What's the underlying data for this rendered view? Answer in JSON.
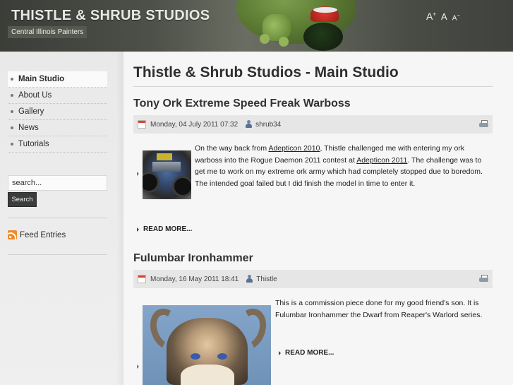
{
  "header": {
    "site_title": "THISTLE & SHRUB STUDIOS",
    "tagline": "Central Illinois Painters",
    "font_tools": {
      "increase": "A",
      "reset": "A",
      "decrease": "A",
      "plus": "+",
      "minus": "−"
    }
  },
  "sidebar": {
    "menu": [
      {
        "label": "Main Studio",
        "active": true
      },
      {
        "label": "About Us"
      },
      {
        "label": "Gallery"
      },
      {
        "label": "News"
      },
      {
        "label": "Tutorials"
      }
    ],
    "search": {
      "placeholder": "search...",
      "button_label": "Search"
    },
    "feed_label": "Feed Entries"
  },
  "main": {
    "heading": "Thistle & Shrub Studios - Main Studio",
    "articles": [
      {
        "title": "Tony Ork Extreme Speed Freak Warboss",
        "date": "Monday, 04 July 2011 07:32",
        "author": "shrub34",
        "body": {
          "t1": "On the way back from ",
          "link1": "Adepticon 2010",
          "t2": ", Thistle challenged me with entering my ork warboss into the Rogue Daemon 2011 contest at ",
          "link2": "Adepticon 2011",
          "t3": ".  The challenge was to get me to work on my extreme ork army which had completely stopped due to boredom.  The intended goal failed but I did finish the model in time to enter it."
        },
        "read_more": "READ MORE..."
      },
      {
        "title": "Fulumbar Ironhammer",
        "date": "Monday, 16 May 2011 18:41",
        "author": "Thistle",
        "body": {
          "t1": "This is a commission piece done for my good friend's son.  It is Fulumbar Ironhammer the Dwarf from Reaper's Warlord series."
        },
        "read_more": "READ MORE..."
      }
    ]
  }
}
